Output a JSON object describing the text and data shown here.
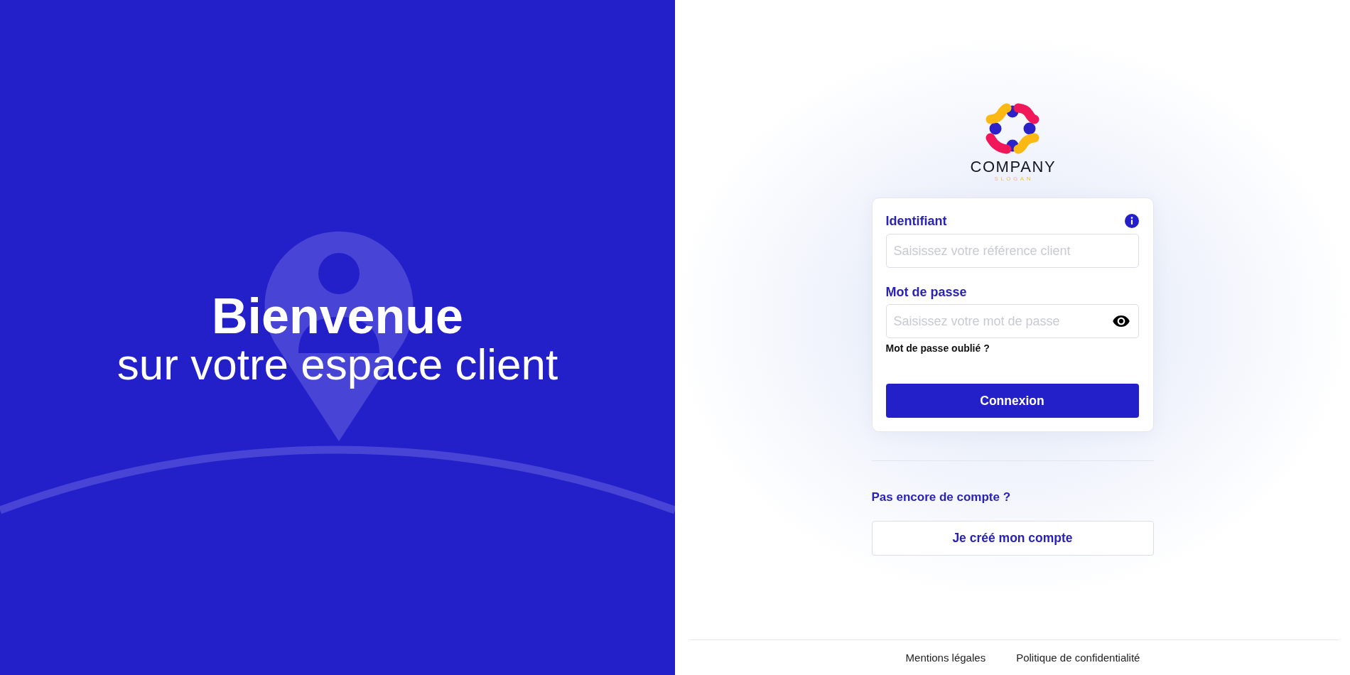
{
  "welcome_panel": {
    "title": "Bienvenue",
    "subtitle": "sur votre espace client"
  },
  "brand": {
    "name": "COMPANY",
    "slogan": "SLOGAN"
  },
  "login_form": {
    "fields": [
      {
        "kind": "text",
        "label": "Identifiant",
        "placeholder": "Saisissez votre référence client"
      },
      {
        "kind": "password",
        "label": "Mot de passe",
        "placeholder": "Saisissez votre mot de passe"
      }
    ],
    "forgot_link": "Mot de passe oublié ?",
    "submit_button": "Connexion"
  },
  "signup": {
    "prompt": "Pas encore de compte ?",
    "button": "Je créé mon compte"
  },
  "footer": {
    "links": [
      "Mentions légales",
      "Politique de confidentialité"
    ]
  }
}
